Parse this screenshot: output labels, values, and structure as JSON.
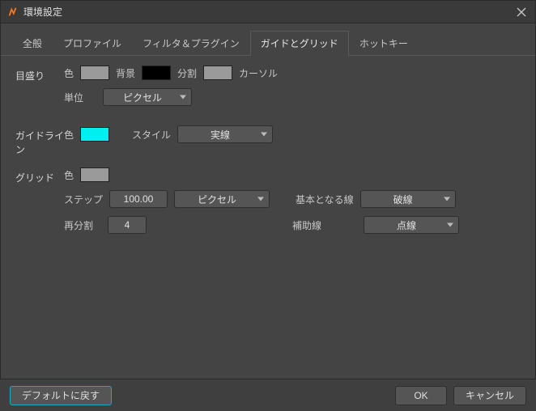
{
  "window": {
    "title": "環境設定"
  },
  "tabs": [
    {
      "label": "全般"
    },
    {
      "label": "プロファイル"
    },
    {
      "label": "フィルタ＆プラグイン"
    },
    {
      "label": "ガイドとグリッド"
    },
    {
      "label": "ホットキー"
    }
  ],
  "activeTab": 3,
  "sections": {
    "ruler": {
      "title": "目盛り",
      "color_label": "色",
      "bg_label": "背景",
      "division_label": "分割",
      "cursor_label": "カーソル",
      "unit_label": "単位",
      "unit_value": "ピクセル"
    },
    "guideline": {
      "title": "ガイドライン",
      "color_label": "色",
      "style_label": "スタイル",
      "style_value": "実線"
    },
    "grid": {
      "title": "グリッド",
      "color_label": "色",
      "step_label": "ステップ",
      "step_value": "100.00",
      "step_unit": "ピクセル",
      "base_label": "基本となる線",
      "base_value": "破線",
      "resub_label": "再分割",
      "resub_value": "4",
      "aux_label": "補助線",
      "aux_value": "点線"
    }
  },
  "colors": {
    "ruler_fg": "#9a9a9a",
    "ruler_bg": "#000000",
    "ruler_div": "#9a9a9a",
    "ruler_cursor": "#9a9a9a",
    "guideline": "#00f0f0",
    "grid": "#9a9a9a"
  },
  "footer": {
    "reset": "デフォルトに戻す",
    "ok": "OK",
    "cancel": "キャンセル"
  }
}
